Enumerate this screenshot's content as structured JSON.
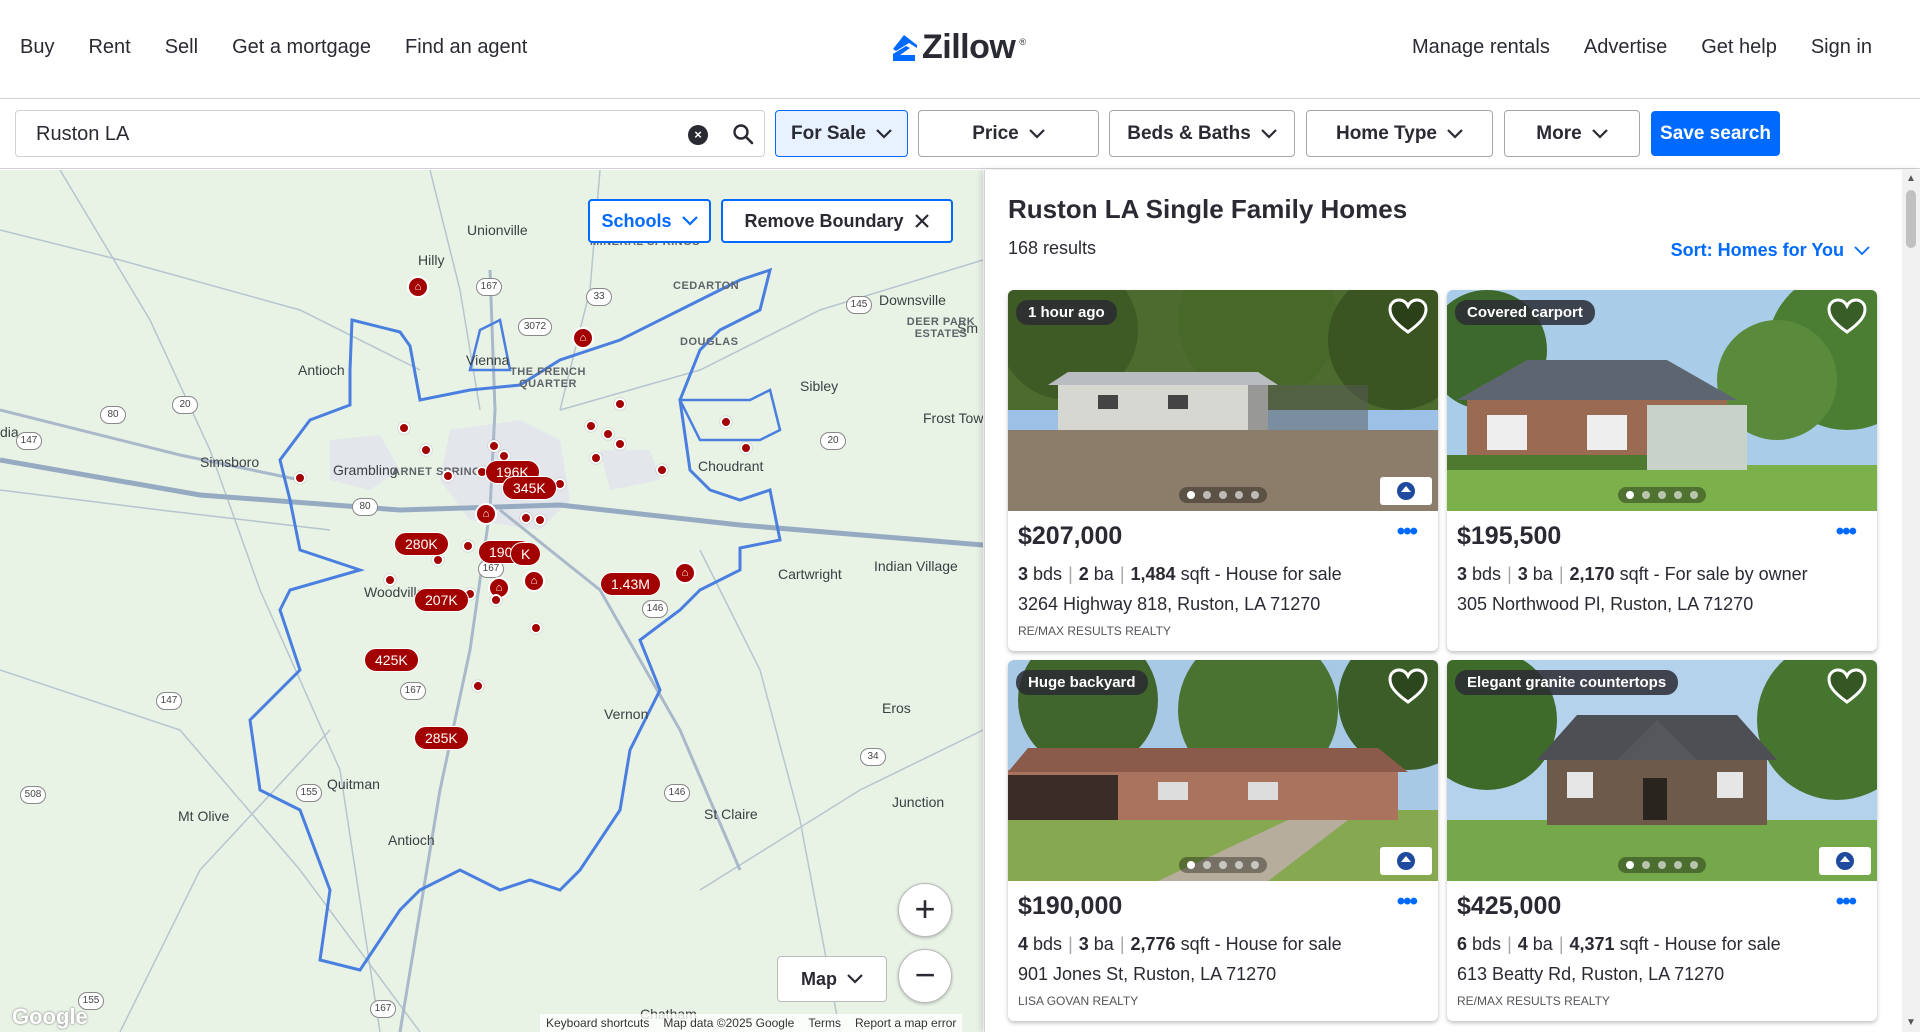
{
  "nav": {
    "left": [
      "Buy",
      "Rent",
      "Sell",
      "Get a mortgage",
      "Find an agent"
    ],
    "right": [
      "Manage rentals",
      "Advertise",
      "Get help",
      "Sign in"
    ],
    "logo_text": "Zillow",
    "logo_tm": "®"
  },
  "filters": {
    "search_value": "Ruston LA",
    "for_sale": "For Sale",
    "price": "Price",
    "beds_baths": "Beds & Baths",
    "home_type": "Home Type",
    "more": "More",
    "save_search": "Save search"
  },
  "map": {
    "schools": "Schools",
    "remove_boundary": "Remove Boundary",
    "map_type": "Map",
    "zoom_in": "+",
    "zoom_out": "−",
    "google": "Google",
    "attribution": [
      "Keyboard shortcuts",
      "Map data ©2025 Google",
      "Terms",
      "Report a map error"
    ],
    "places": [
      "Unionville",
      "Hilly",
      "Downsville",
      "Antioch",
      "Vienna",
      "Sibley",
      "Frost Town",
      "Simsboro",
      "Grambling",
      "Choudrant",
      "Cartwright",
      "Indian Village",
      "Woodville",
      "Vernon",
      "Eros",
      "Quitman",
      "Mt Olive",
      "Antioch",
      "St Claire",
      "Chatham",
      "Sm",
      "dia",
      "Junction"
    ],
    "small_places": [
      "MINERAL SPRINGS",
      "CEDARTON",
      "DEER PARK ESTATES",
      "DOUGLAS",
      "THE FRENCH QUARTER",
      "ARNET SPRINGS"
    ],
    "routes": [
      "167",
      "3072",
      "33",
      "145",
      "80",
      "20",
      "147",
      "20",
      "80",
      "167",
      "146",
      "167",
      "147",
      "155",
      "146",
      "34",
      "508",
      "167",
      "155"
    ],
    "price_tags": [
      "196K",
      "345K",
      "280K",
      "190K",
      "K",
      "1.43M",
      "207K",
      "425K",
      "285K"
    ]
  },
  "results": {
    "title": "Ruston LA Single Family Homes",
    "count": "168 results",
    "sort": "Sort: Homes for You",
    "listings": [
      {
        "badge": "1 hour ago",
        "price": "$207,000",
        "beds": "3",
        "beds_unit": "bds",
        "baths": "2",
        "baths_unit": "ba",
        "sqft": "1,484",
        "sqft_unit": "sqft",
        "type": "- House for sale",
        "address": "3264 Highway 818, Ruston, LA 71270",
        "broker": "RE/MAX RESULTS REALTY"
      },
      {
        "badge": "Covered carport",
        "price": "$195,500",
        "beds": "3",
        "beds_unit": "bds",
        "baths": "3",
        "baths_unit": "ba",
        "sqft": "2,170",
        "sqft_unit": "sqft",
        "type": "- For sale by owner",
        "address": "305 Northwood Pl, Ruston, LA 71270",
        "broker": ""
      },
      {
        "badge": "Huge backyard",
        "price": "$190,000",
        "beds": "4",
        "beds_unit": "bds",
        "baths": "3",
        "baths_unit": "ba",
        "sqft": "2,776",
        "sqft_unit": "sqft",
        "type": "- House for sale",
        "address": "901 Jones St, Ruston, LA 71270",
        "broker": "LISA GOVAN REALTY"
      },
      {
        "badge": "Elegant granite countertops",
        "price": "$425,000",
        "beds": "6",
        "beds_unit": "bds",
        "baths": "4",
        "baths_unit": "ba",
        "sqft": "4,371",
        "sqft_unit": "sqft",
        "type": "- House for sale",
        "address": "613 Beatty Rd, Ruston, LA 71270",
        "broker": "RE/MAX RESULTS REALTY"
      }
    ]
  },
  "colors": {
    "accent": "#006aff",
    "pin": "#a30000",
    "map_bg": "#e8f3e6",
    "boundary": "#4a7fe0"
  },
  "icons": [
    "zillow-logo-icon",
    "clear-icon",
    "search-icon",
    "chevron-down-icon",
    "close-icon",
    "heart-icon",
    "more-dots-icon",
    "mls-logo-icon",
    "home-pin-icon"
  ]
}
